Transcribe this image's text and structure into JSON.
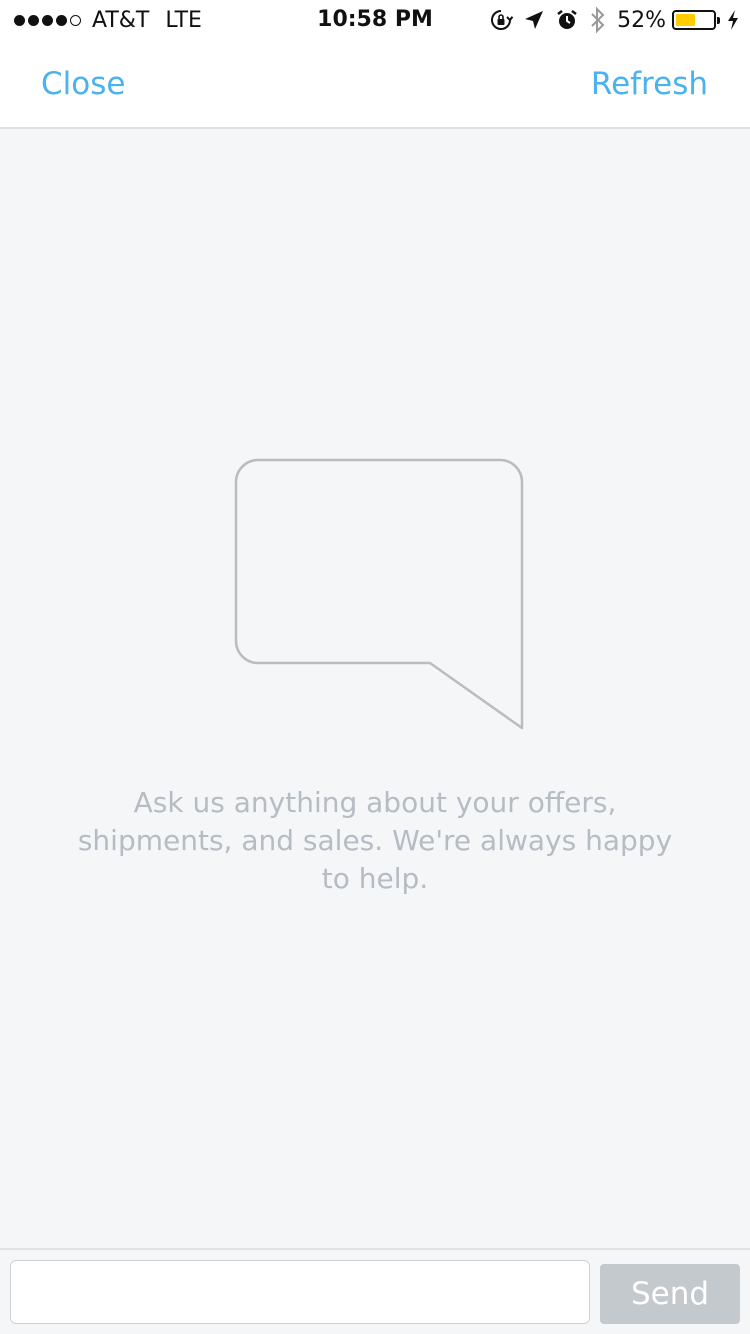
{
  "status_bar": {
    "carrier": "AT&T",
    "network": "LTE",
    "time": "10:58 PM",
    "battery_percent": "52%",
    "battery_level": 0.52,
    "signal_bars_filled": 4,
    "signal_bars_total": 5,
    "icons": [
      "rotation-lock-icon",
      "location-arrow-icon",
      "alarm-icon",
      "bluetooth-icon",
      "battery-icon",
      "charging-bolt-icon"
    ]
  },
  "nav": {
    "close_label": "Close",
    "refresh_label": "Refresh"
  },
  "empty_state": {
    "icon": "speech-bubble-icon",
    "message": "Ask us anything about your offers, shipments, and sales. We're always happy to help."
  },
  "composer": {
    "input_value": "",
    "input_placeholder": "",
    "send_label": "Send"
  },
  "colors": {
    "accent": "#4ab2ef",
    "background": "#f5f6f8",
    "muted_text": "#b6bcc3",
    "send_disabled": "#c4c9ce",
    "battery_fill": "#ffcc00"
  }
}
